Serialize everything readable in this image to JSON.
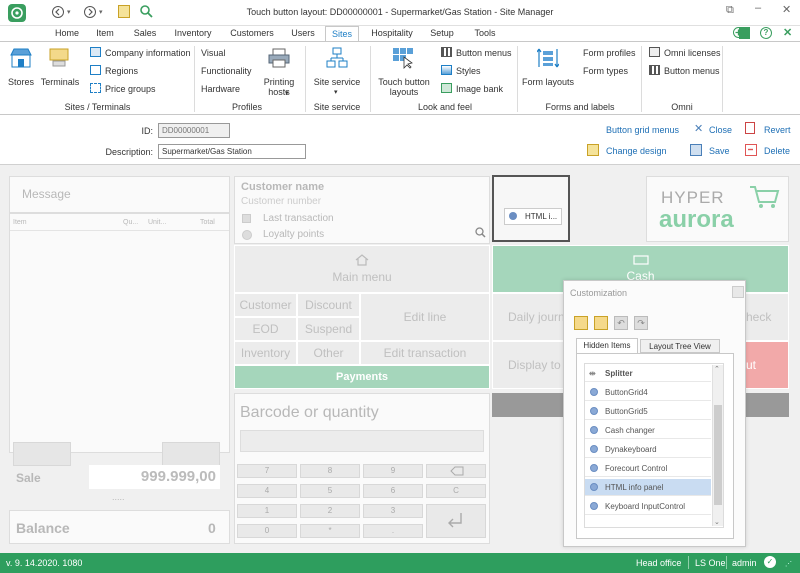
{
  "title": "Touch button layout: DD00000001 - Supermarket/Gas Station - Site Manager",
  "tabs": [
    "Home",
    "Item",
    "Sales",
    "Inventory",
    "Customers",
    "Users",
    "Sites",
    "Hospitality",
    "Setup",
    "Tools"
  ],
  "ribbon": {
    "stores": "Stores",
    "terminals": "Terminals",
    "company_info": "Company information",
    "regions": "Regions",
    "price_groups": "Price groups",
    "grp_sites": "Sites / Terminals",
    "visual": "Visual",
    "functionality": "Functionality",
    "hardware": "Hardware",
    "printing_hosts": "Printing hosts",
    "grp_profiles": "Profiles",
    "site_service": "Site service",
    "grp_site_service": "Site service",
    "touch_button_layouts": "Touch button layouts",
    "button_menus": "Button menus",
    "styles": "Styles",
    "image_bank": "Image bank",
    "grp_look": "Look and feel",
    "form_layouts": "Form layouts",
    "form_profiles": "Form profiles",
    "form_types": "Form types",
    "grp_forms": "Forms and labels",
    "omni_licenses": "Omni licenses",
    "omni_button_menus": "Button menus",
    "grp_omni": "Omni"
  },
  "header": {
    "id_label": "ID:",
    "id_value": "DD00000001",
    "desc_label": "Description:",
    "desc_value": "Supermarket/Gas Station",
    "button_grid_menus": "Button grid menus",
    "close": "Close",
    "revert": "Revert",
    "change_design": "Change design",
    "save": "Save",
    "delete": "Delete"
  },
  "pos": {
    "message": "Message",
    "col_item": "Item",
    "col_qty": "Qu...",
    "col_unit": "Unit...",
    "col_total": "Total",
    "sale_label": "Sale",
    "sale_value": "999.999,00",
    "dots": ".....",
    "balance_label": "Balance",
    "balance_value": "0",
    "customer_name": "Customer name",
    "customer_number": "Customer number",
    "last_transaction": "Last transaction",
    "loyalty_points": "Loyalty points",
    "html_info": "HTML i...",
    "logo_top": "HYPER",
    "logo_bottom": "aurora",
    "main_menu": "Main menu",
    "customer": "Customer",
    "discount": "Discount",
    "edit_line": "Edit line",
    "eod": "EOD",
    "suspend": "Suspend",
    "inventory": "Inventory",
    "other": "Other",
    "edit_transaction": "Edit transaction",
    "payments": "Payments",
    "cash": "Cash",
    "daily_journal": "Daily journ",
    "check": "heck",
    "display_total": "Display to",
    "out": "ut",
    "barcode": "Barcode or quantity",
    "keys": [
      "7",
      "8",
      "9",
      "",
      "4",
      "5",
      "6",
      "C",
      "1",
      "2",
      "3",
      "",
      "0",
      "*",
      ".",
      ""
    ]
  },
  "customization": {
    "title": "Customization",
    "tab_hidden": "Hidden Items",
    "tab_tree": "Layout Tree View",
    "items": [
      "Splitter",
      "ButtonGrid4",
      "ButtonGrid5",
      "Cash changer",
      "Dynakeyboard",
      "Forecourt Control",
      "HTML info panel",
      "Keyboard InputControl"
    ],
    "selected": "HTML info panel"
  },
  "status": {
    "version": "v. 9. 14.2020. 1080",
    "office": "Head office",
    "product": "LS One",
    "user": "admin"
  },
  "colors": {
    "accent": "#1e7fc6",
    "status_bar": "#2e9e5e",
    "payments": "#a5d6bb",
    "delete": "#e05555"
  }
}
